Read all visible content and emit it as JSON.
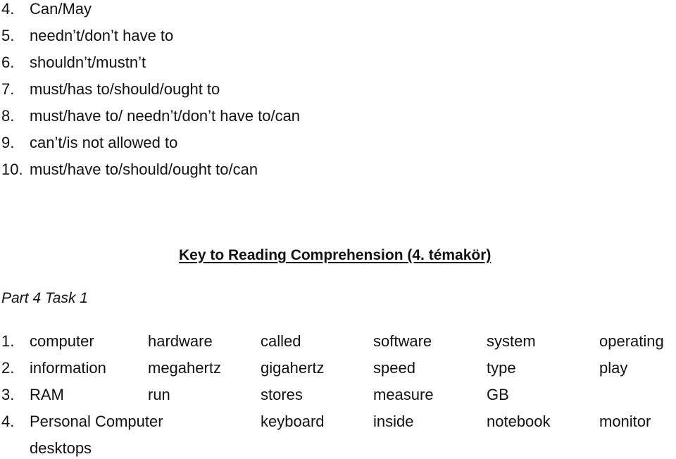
{
  "modal_answers": [
    {
      "number": "4.",
      "text": "Can/May"
    },
    {
      "number": "5.",
      "text": "needn’t/don’t have to"
    },
    {
      "number": "6.",
      "text": "shouldn’t/mustn’t"
    },
    {
      "number": "7.",
      "text": "must/has to/should/ought to"
    },
    {
      "number": "8.",
      "text": "must/have to/ needn’t/don’t have to/can"
    },
    {
      "number": "9.",
      "text": "can’t/is not allowed to"
    },
    {
      "number": "10.",
      "text": "must/have to/should/ought to/can"
    }
  ],
  "key_title": "Key to Reading Comprehension (4. témakör)",
  "part_label": "Part 4 Task 1",
  "answer_rows": [
    {
      "number": "1.",
      "words": [
        "computer",
        "hardware",
        "called",
        "software",
        "system",
        "operating"
      ]
    },
    {
      "number": "2.",
      "words": [
        "information",
        "megahertz",
        "gigahertz",
        "speed",
        "type",
        "play"
      ]
    },
    {
      "number": "3.",
      "words": [
        "RAM",
        "run",
        "stores",
        "measure",
        "GB",
        ""
      ]
    },
    {
      "number": "4.",
      "words": [
        "Personal Computer",
        "",
        "keyboard",
        "inside",
        "notebook",
        "monitor"
      ]
    },
    {
      "number": "",
      "words": [
        "desktops",
        "",
        "",
        "",
        "",
        ""
      ]
    }
  ]
}
